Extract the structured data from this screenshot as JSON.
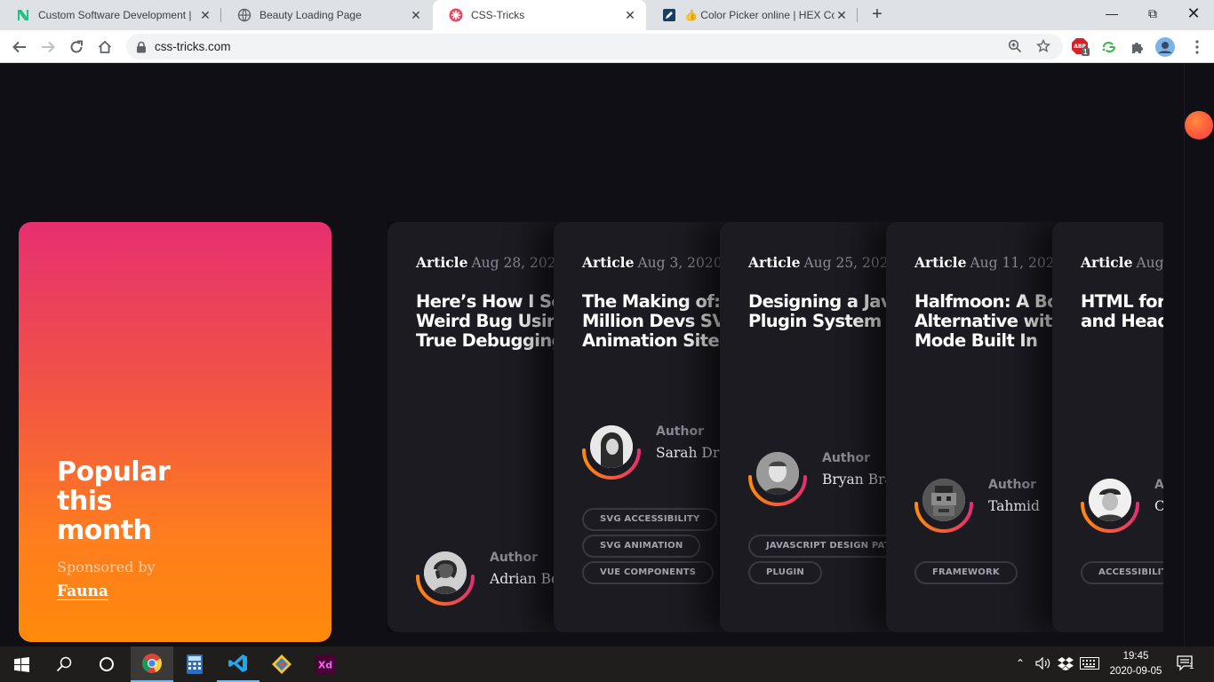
{
  "browser": {
    "tabs": [
      {
        "title": "Custom Software Development |",
        "favicon": "n-logo-icon",
        "active": false
      },
      {
        "title": "Beauty Loading Page",
        "favicon": "globe-icon",
        "active": false
      },
      {
        "title": "CSS-Tricks",
        "favicon": "css-tricks-star-icon",
        "active": true
      },
      {
        "title": "👍 Color Picker online | HEX Colo",
        "favicon": "pen-icon",
        "active": false
      }
    ],
    "url": "css-tricks.com",
    "extension_badge": "1"
  },
  "popular": {
    "title": "Popular\nthis\nmonth",
    "sponsored_by": "Sponsored by",
    "sponsor": "Fauna"
  },
  "cards": [
    {
      "kind": "Article",
      "date": "Aug 28, 2020",
      "title": "Here’s How I Solved a\nWeird Bug Using Tried and\nTrue Debugging Strategies",
      "author_label": "Author",
      "author_name": "Adrian Bece",
      "tags": []
    },
    {
      "kind": "Article",
      "date": "Aug 3, 2020",
      "title": "The Making of: Netlify's\nMillion Devs SVG\nAnimation Site",
      "author_label": "Author",
      "author_name": "Sarah Drasner",
      "tags": [
        "SVG ACCESSIBILITY",
        "SVG ANIMATION",
        "VUE COMPONENTS"
      ]
    },
    {
      "kind": "Article",
      "date": "Aug 25, 2020",
      "title": "Designing a JavaScript\nPlugin System",
      "author_label": "Author",
      "author_name": "Bryan Braun",
      "tags": [
        "JAVASCRIPT DESIGN PATTERNS",
        "PLUGIN"
      ]
    },
    {
      "kind": "Article",
      "date": "Aug 11, 2020",
      "title": "Halfmoon: A Bootstrap\nAlternative with Dark\nMode Built In",
      "author_label": "Author",
      "author_name": "Tahmid",
      "tags": [
        "FRAMEWORK"
      ]
    },
    {
      "kind": "Article",
      "date": "Aug 6, 2020",
      "title": "HTML for Subheadings\nand Headings",
      "author_label": "Author",
      "author_name": "Chris Coyier",
      "tags": [
        "ACCESSIBILITY"
      ]
    }
  ],
  "taskbar": {
    "time": "19:45",
    "date": "2020-09-05",
    "notification_count": "1"
  },
  "colors": {
    "page_bg": "#100f16",
    "card_bg": "#1c1b22",
    "popular_gradient_top": "#e62f70",
    "popular_gradient_bottom": "#ff8a0b",
    "ring_orange": "#ff8a0b",
    "ring_pink": "#e62f70"
  }
}
